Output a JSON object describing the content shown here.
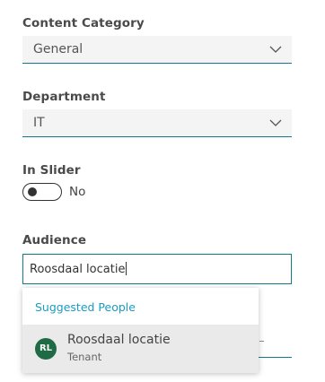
{
  "fields": {
    "content_category": {
      "label": "Content Category",
      "value": "General"
    },
    "department": {
      "label": "Department",
      "value": "IT"
    },
    "in_slider": {
      "label": "In Slider",
      "state_text": "No",
      "on": false
    },
    "audience": {
      "label": "Audience",
      "value": "Roosdaal locatie"
    }
  },
  "suggestions": {
    "header": "Suggested People",
    "items": [
      {
        "initials": "RL",
        "name": "Roosdaal locatie",
        "subtitle": "Tenant"
      }
    ]
  },
  "colors": {
    "accent": "#0f7b84",
    "link": "#1a9cc2",
    "avatar": "#1f6b45",
    "field_bg": "#f4f4f4"
  },
  "icons": {
    "select_chevron": "chevron-down-icon"
  }
}
